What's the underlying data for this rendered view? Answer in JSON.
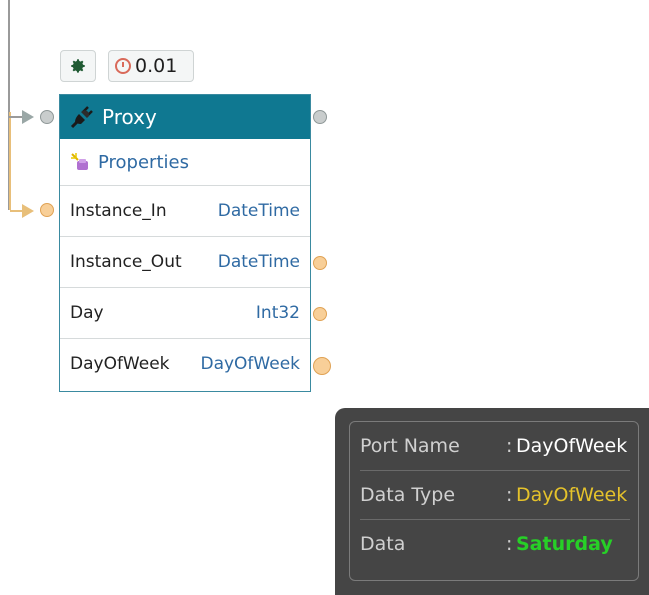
{
  "toolbar": {
    "settings_icon": "gear-icon",
    "timer_icon": "timer-icon",
    "timer_value": "0.01"
  },
  "node": {
    "title": "Proxy",
    "header_color": "#0f7891",
    "properties_label": "Properties",
    "ports": [
      {
        "name": "Instance_In",
        "type": "DateTime"
      },
      {
        "name": "Instance_Out",
        "type": "DateTime"
      },
      {
        "name": "Day",
        "type": "Int32"
      },
      {
        "name": "DayOfWeek",
        "type": "DayOfWeek"
      }
    ]
  },
  "tooltip": {
    "rows": [
      {
        "label": "Port Name",
        "sep": ":",
        "value": "DayOfWeek",
        "color": "#ffffff"
      },
      {
        "label": "Data Type",
        "sep": ":",
        "value": "DayOfWeek",
        "color": "#e5c22b"
      },
      {
        "label": "Data",
        "sep": ":",
        "value": "Saturday",
        "color": "#27d027"
      }
    ]
  }
}
